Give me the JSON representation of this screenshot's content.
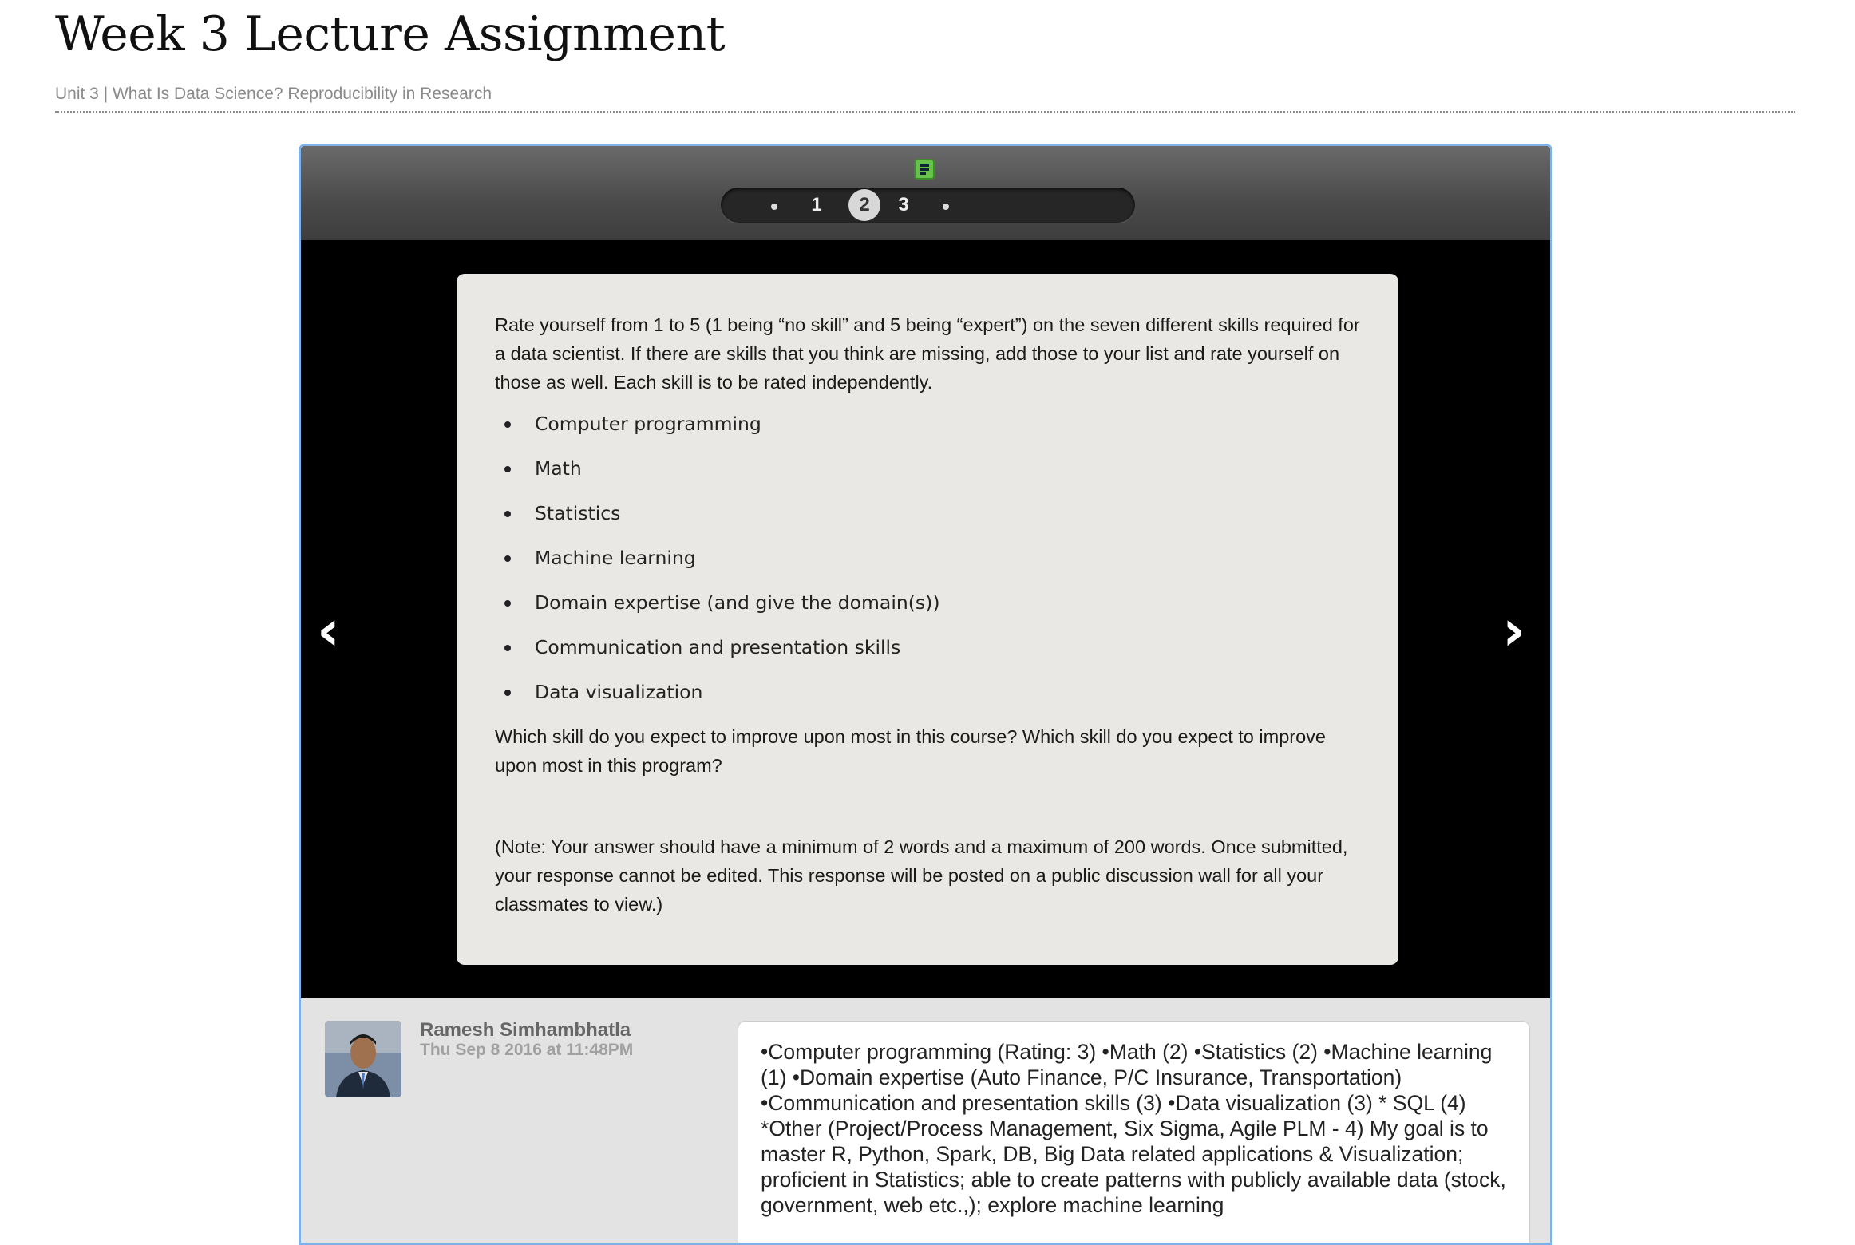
{
  "page": {
    "title": "Week 3 Lecture Assignment",
    "breadcrumb": "Unit 3 | What Is Data Science? Reproducibility in Research"
  },
  "viewer": {
    "pager": {
      "pages": [
        "1",
        "2",
        "3"
      ],
      "current": "2"
    },
    "prev_arrow": "‹",
    "next_arrow": "›",
    "slide": {
      "intro": "Rate yourself from 1 to 5 (1 being “no skill” and 5 being “expert”) on the seven different skills required for a data scientist. If there are skills that you think are missing, add those to your list and rate yourself on those as well. Each skill is to be rated independently.",
      "skills": [
        "Computer programming",
        "Math",
        "Statistics",
        "Machine learning",
        "Domain expertise (and give the domain(s))",
        "Communication and presentation skills",
        "Data visualization"
      ],
      "question": "Which skill do you expect to improve upon most in this course? Which skill do you expect to improve upon most in this program?",
      "note": "(Note: Your answer should have a minimum of 2 words and a maximum of 200 words. Once submitted, your response cannot be edited. This response will be posted on a public discussion wall for all your classmates to view.)"
    }
  },
  "response": {
    "author": "Ramesh Simhambhatla",
    "timestamp": "Thu Sep 8 2016 at 11:48PM",
    "text": "•Computer programming (Rating: 3) •Math (2) •Statistics (2) •Machine learning (1) •Domain expertise (Auto Finance, P/C Insurance, Transportation) •Communication and presentation skills (3) •Data visualization (3) * SQL (4) *Other (Project/Process Management, Six Sigma, Agile PLM - 4) My goal is to master R, Python, Spark, DB, Big Data related applications & Visualization; proficient in Statistics; able to create patterns with publicly available data (stock, government, web etc.,); explore machine learning"
  },
  "colors": {
    "viewer_border": "#7fb0e6",
    "slides_icon": "#66c24a"
  }
}
